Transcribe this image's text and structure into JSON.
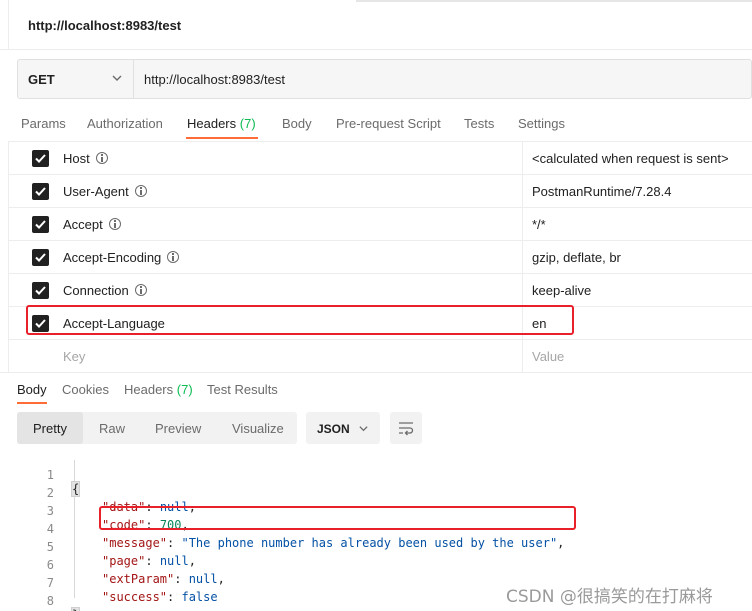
{
  "request": {
    "title": "http://localhost:8983/test",
    "method": "GET",
    "url": "http://localhost:8983/test"
  },
  "request_tabs": [
    {
      "label": "Params",
      "count": ""
    },
    {
      "label": "Authorization",
      "count": ""
    },
    {
      "label": "Headers",
      "count": "(7)"
    },
    {
      "label": "Body",
      "count": ""
    },
    {
      "label": "Pre-request Script",
      "count": ""
    },
    {
      "label": "Tests",
      "count": ""
    },
    {
      "label": "Settings",
      "count": ""
    }
  ],
  "headers": [
    {
      "key": "Host",
      "value": "<calculated when request is sent>"
    },
    {
      "key": "User-Agent",
      "value": "PostmanRuntime/7.28.4"
    },
    {
      "key": "Accept",
      "value": "*/*"
    },
    {
      "key": "Accept-Encoding",
      "value": "gzip, deflate, br"
    },
    {
      "key": "Connection",
      "value": "keep-alive"
    },
    {
      "key": "Accept-Language",
      "value": "en"
    }
  ],
  "header_placeholders": {
    "key": "Key",
    "value": "Value"
  },
  "response_tabs": [
    {
      "label": "Body",
      "count": ""
    },
    {
      "label": "Cookies",
      "count": ""
    },
    {
      "label": "Headers",
      "count": "(7)"
    },
    {
      "label": "Test Results",
      "count": ""
    }
  ],
  "view_modes": [
    "Pretty",
    "Raw",
    "Preview",
    "Visualize"
  ],
  "format": "JSON",
  "code_lines": [
    {
      "n": "1",
      "key": "",
      "value": "",
      "value_type": "brace_open"
    },
    {
      "n": "2",
      "key": "\"data\"",
      "value": "null",
      "value_type": "kw",
      "comma": ","
    },
    {
      "n": "3",
      "key": "\"code\"",
      "value": "700",
      "value_type": "num",
      "comma": ","
    },
    {
      "n": "4",
      "key": "\"message\"",
      "value": "\"The phone number has already been used by the user\"",
      "value_type": "str",
      "comma": ","
    },
    {
      "n": "5",
      "key": "\"page\"",
      "value": "null",
      "value_type": "kw",
      "comma": ","
    },
    {
      "n": "6",
      "key": "\"extParam\"",
      "value": "null",
      "value_type": "kw",
      "comma": ","
    },
    {
      "n": "7",
      "key": "\"success\"",
      "value": "false",
      "value_type": "kw",
      "comma": ""
    },
    {
      "n": "8",
      "key": "",
      "value": "",
      "value_type": "brace_close"
    }
  ],
  "braces": {
    "open": "{",
    "close": "}"
  },
  "watermark": "CSDN @很搞笑的在打麻将",
  "colors": {
    "accent": "#ff6c37",
    "count": "#0cbb52",
    "highlight_box": "#e8202a",
    "json_key": "#a31515",
    "json_value": "#0451a5",
    "json_number": "#098658"
  }
}
